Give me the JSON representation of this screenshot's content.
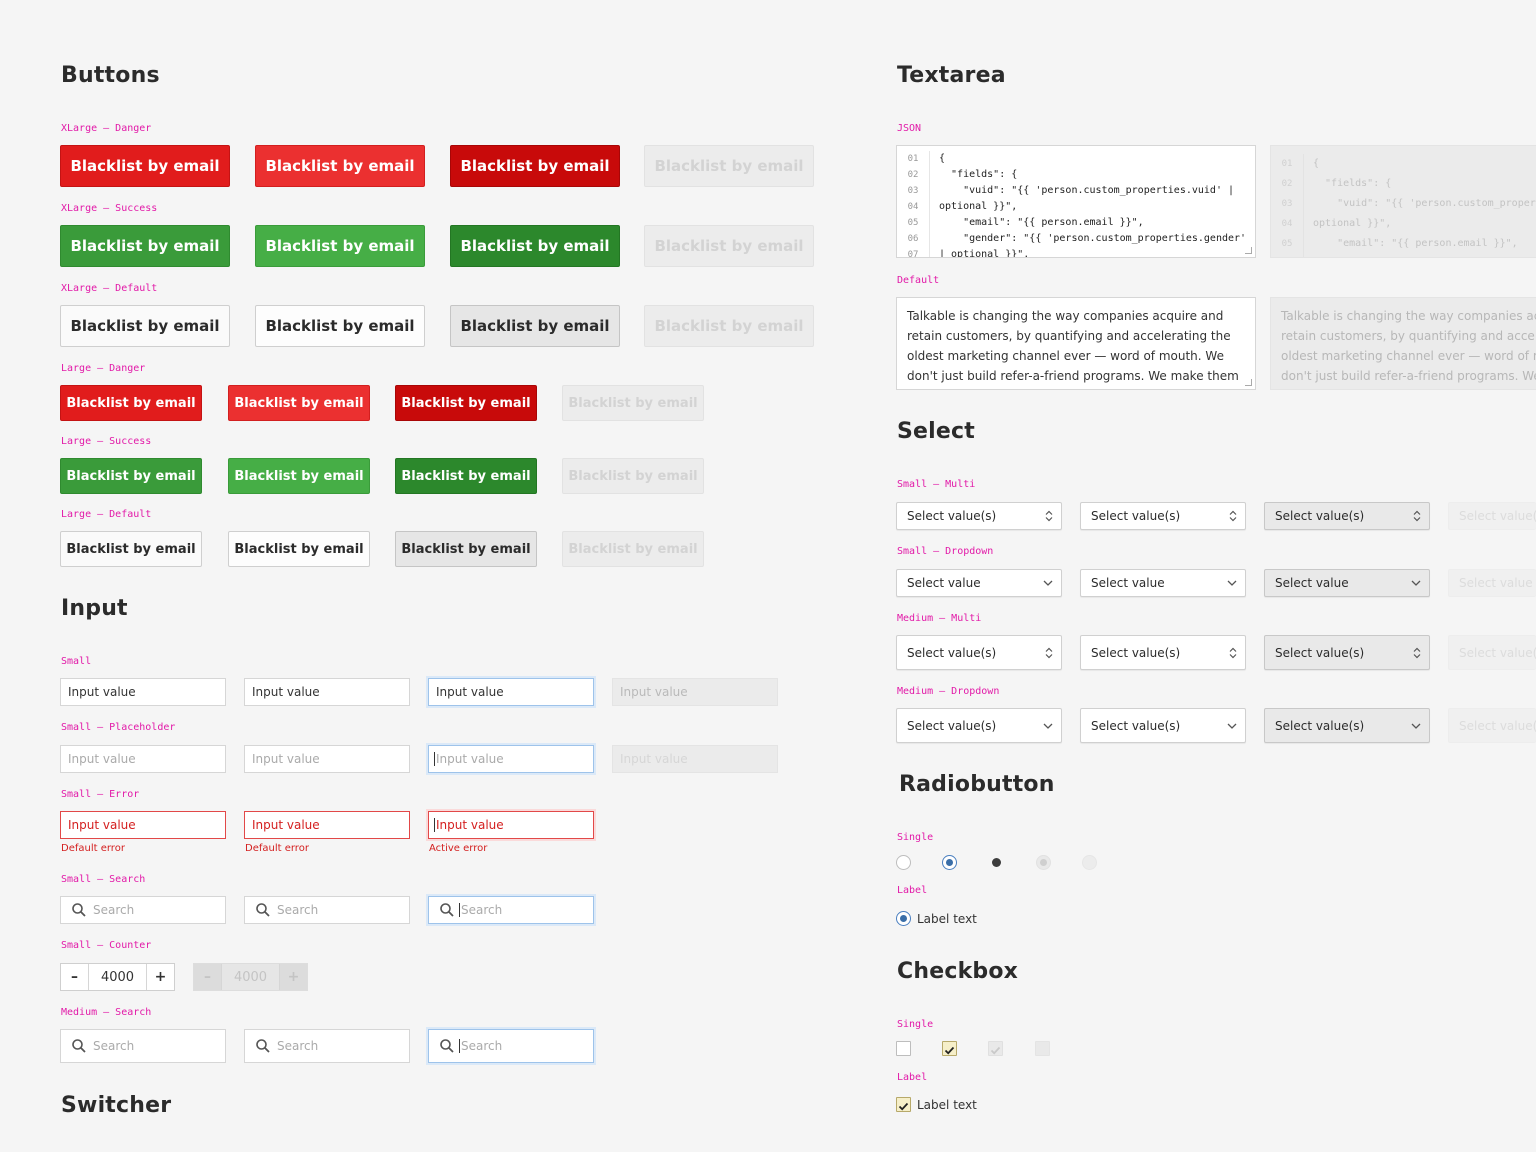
{
  "sections": {
    "buttons": "Buttons",
    "input": "Input",
    "switcher": "Switcher",
    "textarea": "Textarea",
    "select": "Select",
    "radiobutton": "Radiobutton",
    "checkbox": "Checkbox"
  },
  "labels": {
    "xl_danger": "XLarge – Danger",
    "xl_success": "XLarge – Success",
    "xl_default": "XLarge – Default",
    "l_danger": "Large – Danger",
    "l_success": "Large – Success",
    "l_default": "Large – Default",
    "input_small": "Small",
    "input_placeholder": "Small – Placeholder",
    "input_error": "Small – Error",
    "input_search": "Small – Search",
    "input_counter": "Small – Counter",
    "input_medium_search": "Medium – Search",
    "ta_json": "JSON",
    "ta_default": "Default",
    "sel_small_multi": "Small – Multi",
    "sel_small_dropdown": "Small – Dropdown",
    "sel_medium_multi": "Medium – Multi",
    "sel_medium_dropdown": "Medium – Dropdown",
    "radio_single": "Single",
    "radio_label": "Label",
    "check_single": "Single",
    "check_label": "Label"
  },
  "button_label": "Blacklist by email",
  "input": {
    "value": "Input value",
    "placeholder": "Input value",
    "default_error": "Default error",
    "active_error": "Active error",
    "search_placeholder": "Search",
    "counter_value": "4000",
    "counter_minus": "–",
    "counter_plus": "+"
  },
  "textarea": {
    "json_lines": [
      "01",
      "02",
      "03",
      "04",
      "05",
      "06",
      "07"
    ],
    "json_code": "{\n  \"fields\": {\n    \"vuid\": \"{{ 'person.custom_properties.vuid' |\noptional }}\",\n    \"email\": \"{{ person.email }}\",\n    \"gender\": \"{{ 'person.custom_properties.gender'\n| optional }}\",",
    "json_disabled_lines": [
      "01",
      "02",
      "03",
      "04",
      "05"
    ],
    "json_disabled_code": "{\n  \"fields\": {\n    \"vuid\": \"{{ 'person.custom_properties.vuid' |\noptional }}\",\n    \"email\": \"{{ person.email }}\",",
    "prose": "Talkable is changing the way companies acquire and retain customers, by quantifying and accelerating the oldest marketing channel ever — word of mouth. We don't just build refer-a-friend programs. We make them"
  },
  "select": {
    "multi": "Select value(s)",
    "dropdown": "Select value"
  },
  "radio": {
    "label_text": "Label text"
  },
  "checkbox": {
    "label_text": "Label text"
  }
}
